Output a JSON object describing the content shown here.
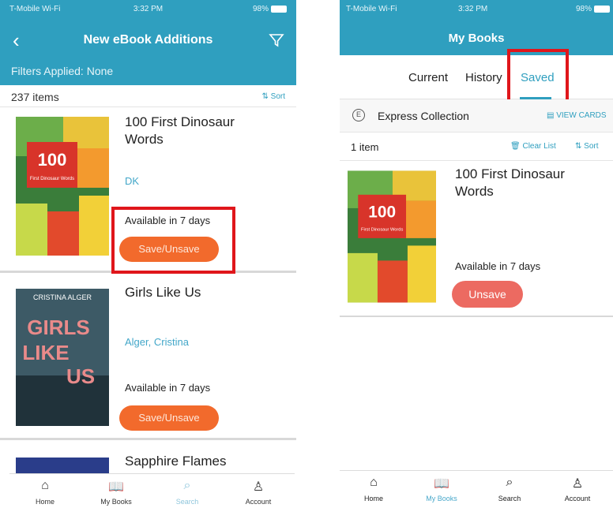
{
  "left": {
    "status": {
      "carrier": "T-Mobile Wi-Fi",
      "time": "3:32 PM",
      "battery": "98%"
    },
    "header": {
      "title": "New eBook Additions",
      "filters": "Filters Applied: None"
    },
    "count": "237 items",
    "sort_label": "Sort",
    "books": [
      {
        "title_line1": "100 First Dinosaur",
        "title_line2": "Words",
        "author": "DK",
        "availability": "Available in 7 days",
        "button": "Save/Unsave",
        "cover_text": "100",
        "cover_sub": "First Dinosaur Words"
      },
      {
        "title_line1": "Girls Like Us",
        "author": "Alger, Cristina",
        "availability": "Available in 7 days",
        "button": "Save/Unsave",
        "cover_author": "CRISTINA ALGER",
        "cover_w1": "GIRLS",
        "cover_w2": "LIKE",
        "cover_w3": "US"
      },
      {
        "title_line1": "Sapphire Flames"
      }
    ],
    "tabs": [
      {
        "label": "Home"
      },
      {
        "label": "My Books"
      },
      {
        "label": "Search"
      },
      {
        "label": "Account"
      }
    ]
  },
  "right": {
    "status": {
      "carrier": "T-Mobile Wi-Fi",
      "time": "3:32 PM",
      "battery": "98%"
    },
    "header": {
      "title": "My Books"
    },
    "tabs": [
      {
        "label": "Current"
      },
      {
        "label": "History"
      },
      {
        "label": "Saved"
      }
    ],
    "express": {
      "label": "Express Collection",
      "view_cards": "VIEW CARDS"
    },
    "count": "1 item",
    "clear_list": "Clear List",
    "sort_label": "Sort",
    "book": {
      "title_line1": "100 First Dinosaur",
      "title_line2": "Words",
      "availability": "Available in 7 days",
      "button": "Unsave",
      "cover_text": "100",
      "cover_sub": "First Dinosaur Words"
    },
    "bottom_tabs": [
      {
        "label": "Home"
      },
      {
        "label": "My Books"
      },
      {
        "label": "Search"
      },
      {
        "label": "Account"
      }
    ]
  },
  "colors": {
    "header": "#2f9fbf",
    "orange_button": "#f26a2c",
    "salmon_button": "#ec6a61",
    "highlight": "#e0161b",
    "link": "#43a7c9"
  }
}
